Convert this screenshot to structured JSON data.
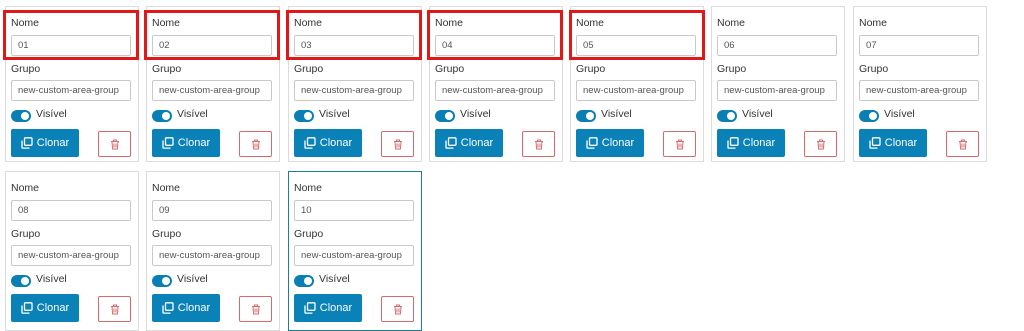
{
  "labels": {
    "name": "Nome",
    "group": "Grupo",
    "visible": "Visível",
    "clone": "Clonar"
  },
  "cards": [
    {
      "name": "01",
      "group": "new-custom-area-group",
      "visible": true,
      "highlighted": true
    },
    {
      "name": "02",
      "group": "new-custom-area-group",
      "visible": true,
      "highlighted": true
    },
    {
      "name": "03",
      "group": "new-custom-area-group",
      "visible": true,
      "highlighted": true
    },
    {
      "name": "04",
      "group": "new-custom-area-group",
      "visible": true,
      "highlighted": true
    },
    {
      "name": "05",
      "group": "new-custom-area-group",
      "visible": true,
      "highlighted": true
    },
    {
      "name": "06",
      "group": "new-custom-area-group",
      "visible": true,
      "highlighted": false
    },
    {
      "name": "07",
      "group": "new-custom-area-group",
      "visible": true,
      "highlighted": false
    },
    {
      "name": "08",
      "group": "new-custom-area-group",
      "visible": true,
      "highlighted": false
    },
    {
      "name": "09",
      "group": "new-custom-area-group",
      "visible": true,
      "highlighted": false
    },
    {
      "name": "10",
      "group": "new-custom-area-group",
      "visible": true,
      "highlighted": false,
      "selected": true
    }
  ],
  "colors": {
    "primary": "#0a82b8",
    "danger": "#d66b6b",
    "highlight": "#e01818",
    "selected_border": "#1e7f93"
  },
  "icons": {
    "clone": "copy-icon",
    "delete": "trash-icon"
  }
}
